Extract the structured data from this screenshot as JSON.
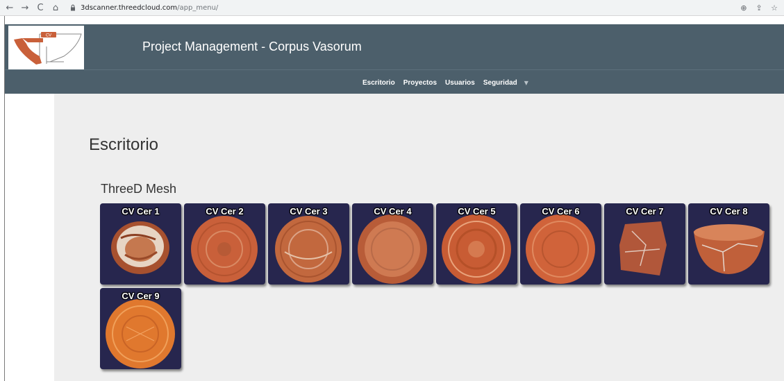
{
  "browser": {
    "url_domain": "3dscanner.threedcloud.com",
    "url_path": "/app_menu/"
  },
  "header": {
    "title": "Project Management - Corpus Vasorum",
    "logo_text": "CV"
  },
  "menu": {
    "items": [
      "Escritorio",
      "Proyectos",
      "Usuarios",
      "Seguridad"
    ]
  },
  "main": {
    "page_title": "Escritorio",
    "section_title": "ThreeD Mesh",
    "tiles": [
      {
        "label": "CV Cer 1"
      },
      {
        "label": "CV Cer 2"
      },
      {
        "label": "CV Cer 3"
      },
      {
        "label": "CV Cer 4"
      },
      {
        "label": "CV Cer 5"
      },
      {
        "label": "CV Cer 6"
      },
      {
        "label": "CV Cer 7"
      },
      {
        "label": "CV Cer 8"
      },
      {
        "label": "CV Cer 9"
      }
    ]
  },
  "colors": {
    "header_bg": "#4c5f6b",
    "tile_bg": "#27264e",
    "main_bg": "#eeeeee",
    "ceramic": "#c9603a"
  }
}
